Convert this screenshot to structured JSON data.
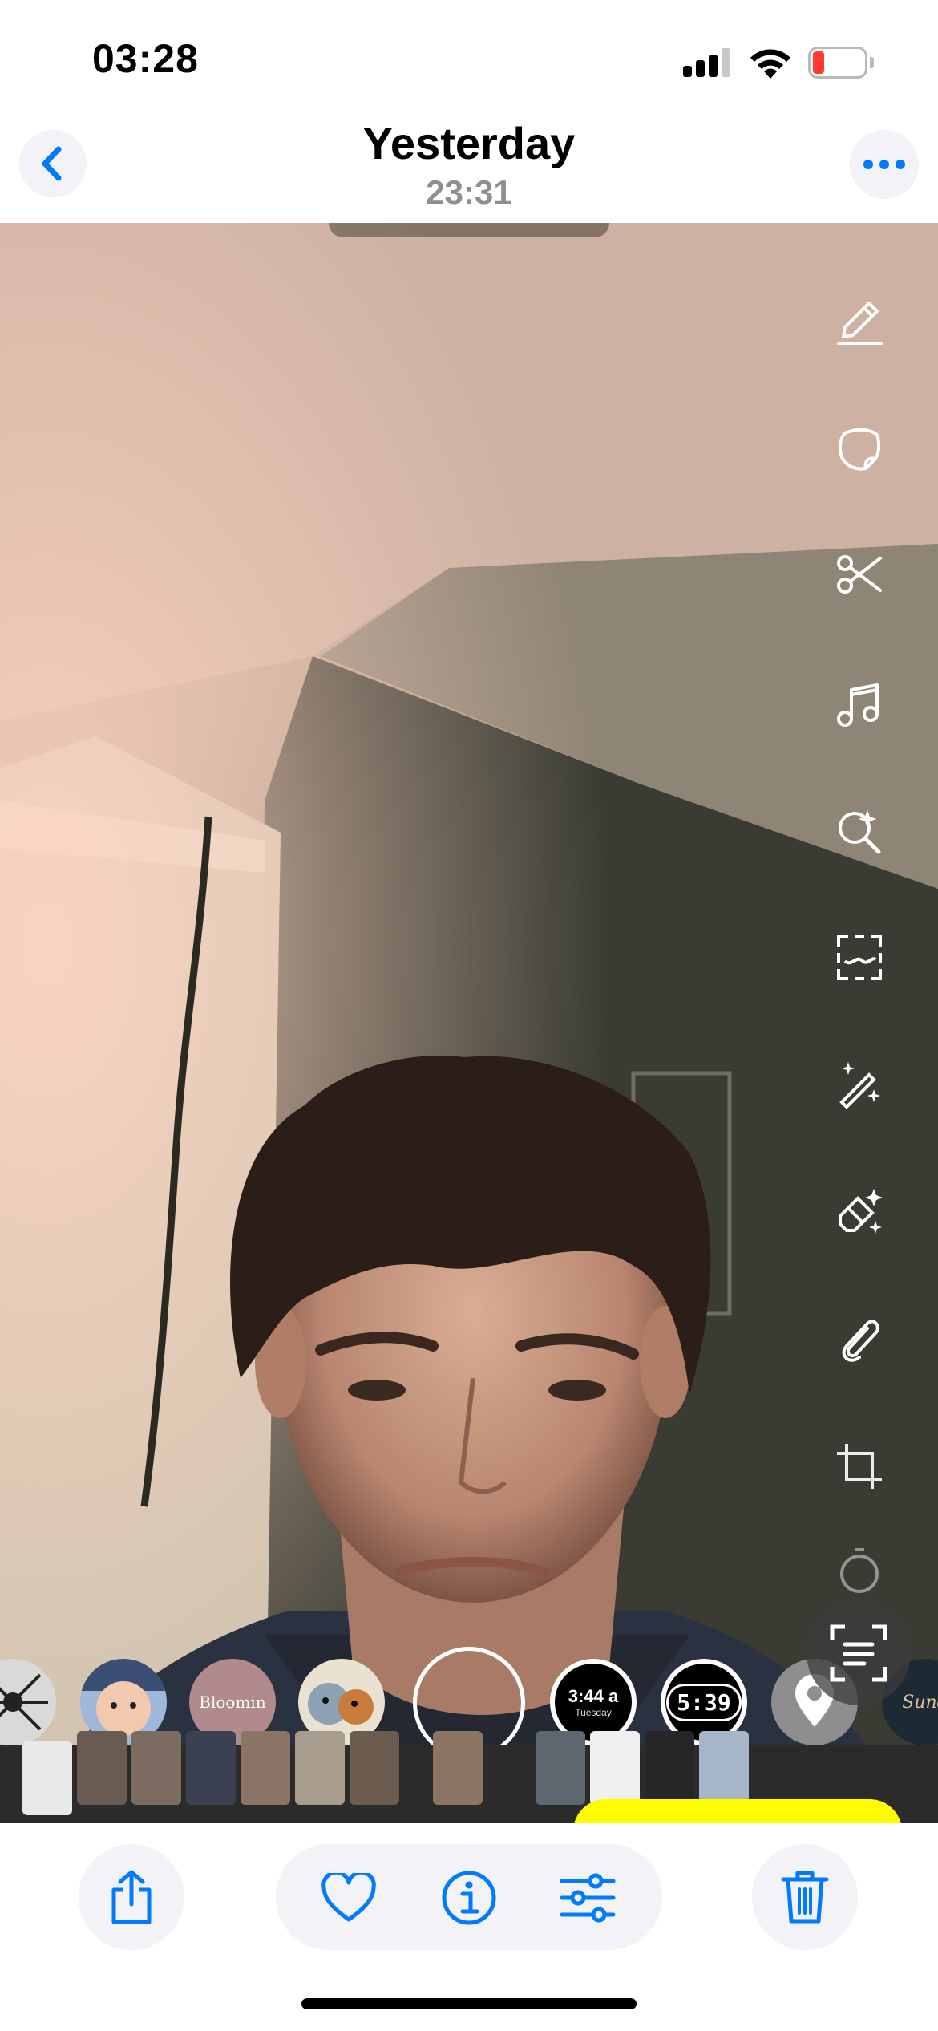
{
  "status_bar": {
    "time": "03:28",
    "battery_level": 0.15,
    "battery_color": "#ff3b30",
    "signal_bars_active": 3
  },
  "nav": {
    "title": "Yesterday",
    "subtitle": "23:31",
    "back_icon": "chevron-left-icon",
    "more_icon": "ellipsis-icon",
    "accent": "#007aff"
  },
  "photo_tools": [
    {
      "name": "pencil-icon"
    },
    {
      "name": "sticker-icon"
    },
    {
      "name": "scissors-icon"
    },
    {
      "name": "music-note-icon"
    },
    {
      "name": "search-sparkle-icon"
    },
    {
      "name": "scan-frame-icon"
    },
    {
      "name": "magic-wand-icon"
    },
    {
      "name": "ai-eraser-icon"
    },
    {
      "name": "paperclip-icon"
    },
    {
      "name": "crop-icon"
    },
    {
      "name": "timer-icon"
    }
  ],
  "lenses": {
    "bloomin_label": "Bloomin",
    "clock_time": "3:44 a",
    "clock_day": "Tuesday",
    "digital_clock": "5:39",
    "location_icon": "location-pin-icon",
    "last_label": "Sund"
  },
  "toolbar": {
    "share_icon": "share-icon",
    "favorite_icon": "heart-icon",
    "info_icon": "info-icon",
    "adjust_icon": "sliders-icon",
    "delete_icon": "trash-icon"
  }
}
